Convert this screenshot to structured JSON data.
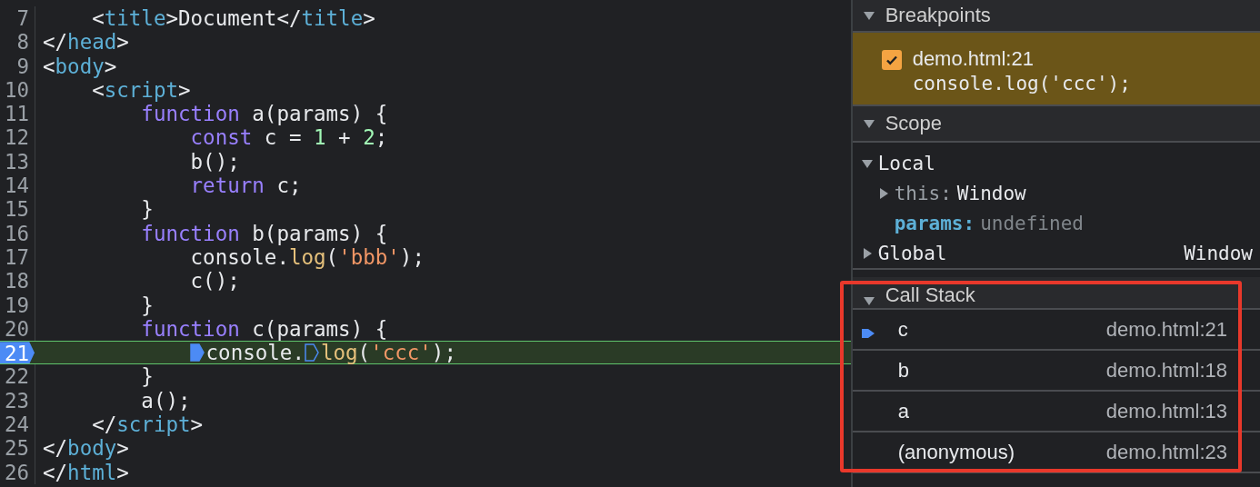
{
  "editor": {
    "lines": [
      {
        "number": "7",
        "current": false,
        "tokens": [
          {
            "text": "    <",
            "kind": "punct"
          },
          {
            "text": "title",
            "kind": "tag"
          },
          {
            "text": ">Document</",
            "kind": "punct"
          },
          {
            "text": "title",
            "kind": "tag"
          },
          {
            "text": ">",
            "kind": "punct"
          }
        ]
      },
      {
        "number": "8",
        "current": false,
        "tokens": [
          {
            "text": "</",
            "kind": "punct"
          },
          {
            "text": "head",
            "kind": "tag"
          },
          {
            "text": ">",
            "kind": "punct"
          }
        ]
      },
      {
        "number": "9",
        "current": false,
        "tokens": [
          {
            "text": "<",
            "kind": "punct"
          },
          {
            "text": "body",
            "kind": "tag"
          },
          {
            "text": ">",
            "kind": "punct"
          }
        ]
      },
      {
        "number": "10",
        "current": false,
        "tokens": [
          {
            "text": "    <",
            "kind": "punct"
          },
          {
            "text": "script",
            "kind": "tag"
          },
          {
            "text": ">",
            "kind": "punct"
          }
        ]
      },
      {
        "number": "11",
        "current": false,
        "tokens": [
          {
            "text": "        function",
            "kind": "keyword"
          },
          {
            "text": " a(params) {",
            "kind": "punct"
          }
        ]
      },
      {
        "number": "12",
        "current": false,
        "tokens": [
          {
            "text": "            const",
            "kind": "keyword"
          },
          {
            "text": " c = ",
            "kind": "punct"
          },
          {
            "text": "1",
            "kind": "number"
          },
          {
            "text": " + ",
            "kind": "punct"
          },
          {
            "text": "2",
            "kind": "number"
          },
          {
            "text": ";",
            "kind": "punct"
          }
        ]
      },
      {
        "number": "13",
        "current": false,
        "tokens": [
          {
            "text": "            b();",
            "kind": "punct"
          }
        ]
      },
      {
        "number": "14",
        "current": false,
        "tokens": [
          {
            "text": "            return",
            "kind": "keyword"
          },
          {
            "text": " c;",
            "kind": "punct"
          }
        ]
      },
      {
        "number": "15",
        "current": false,
        "tokens": [
          {
            "text": "        }",
            "kind": "punct"
          }
        ]
      },
      {
        "number": "16",
        "current": false,
        "tokens": [
          {
            "text": "        function",
            "kind": "keyword"
          },
          {
            "text": " b(params) {",
            "kind": "punct"
          }
        ]
      },
      {
        "number": "17",
        "current": false,
        "tokens": [
          {
            "text": "            console.",
            "kind": "punct"
          },
          {
            "text": "log",
            "kind": "method"
          },
          {
            "text": "(",
            "kind": "punct"
          },
          {
            "text": "'bbb'",
            "kind": "string"
          },
          {
            "text": ");",
            "kind": "punct"
          }
        ]
      },
      {
        "number": "18",
        "current": false,
        "tokens": [
          {
            "text": "            c();",
            "kind": "punct"
          }
        ]
      },
      {
        "number": "19",
        "current": false,
        "tokens": [
          {
            "text": "        }",
            "kind": "punct"
          }
        ]
      },
      {
        "number": "20",
        "current": false,
        "tokens": [
          {
            "text": "        function",
            "kind": "keyword"
          },
          {
            "text": " c(params) {",
            "kind": "punct"
          }
        ]
      },
      {
        "number": "21",
        "current": true,
        "tokens": [
          {
            "text": "            console.",
            "kind": "punct",
            "marker": true,
            "marker_active": true
          },
          {
            "text": "log",
            "kind": "method",
            "marker": true,
            "marker_active": false
          },
          {
            "text": "(",
            "kind": "punct"
          },
          {
            "text": "'ccc'",
            "kind": "string"
          },
          {
            "text": ");",
            "kind": "punct"
          }
        ]
      },
      {
        "number": "22",
        "current": false,
        "tokens": [
          {
            "text": "        }",
            "kind": "punct"
          }
        ]
      },
      {
        "number": "23",
        "current": false,
        "tokens": [
          {
            "text": "        a();",
            "kind": "punct"
          }
        ]
      },
      {
        "number": "24",
        "current": false,
        "tokens": [
          {
            "text": "    </",
            "kind": "punct"
          },
          {
            "text": "script",
            "kind": "tag"
          },
          {
            "text": ">",
            "kind": "punct"
          }
        ]
      },
      {
        "number": "25",
        "current": false,
        "tokens": [
          {
            "text": "</",
            "kind": "punct"
          },
          {
            "text": "body",
            "kind": "tag"
          },
          {
            "text": ">",
            "kind": "punct"
          }
        ]
      },
      {
        "number": "26",
        "current": false,
        "tokens": [
          {
            "text": "</",
            "kind": "punct"
          },
          {
            "text": "html",
            "kind": "tag"
          },
          {
            "text": ">",
            "kind": "punct"
          }
        ]
      }
    ]
  },
  "breakpoints": {
    "title": "Breakpoints",
    "expanded": true,
    "items": [
      {
        "location": "demo.html:21",
        "code": "console.log('ccc');",
        "checked": true
      }
    ]
  },
  "scope": {
    "title": "Scope",
    "expanded": true,
    "groups": [
      {
        "name": "Local",
        "expanded": true,
        "children": [
          {
            "name": "this:",
            "value": "Window",
            "kind": "object",
            "expanded": false
          },
          {
            "name": "params:",
            "value": "undefined",
            "kind": "primitive"
          }
        ]
      },
      {
        "name": "Global",
        "expanded": false,
        "value": "Window"
      }
    ]
  },
  "call_stack": {
    "title": "Call Stack",
    "expanded": true,
    "frames": [
      {
        "name": "c",
        "location": "demo.html:21",
        "selected": true
      },
      {
        "name": "b",
        "location": "demo.html:18",
        "selected": false
      },
      {
        "name": "a",
        "location": "demo.html:13",
        "selected": false
      },
      {
        "name": "(anonymous)",
        "location": "demo.html:23",
        "selected": false
      }
    ]
  }
}
